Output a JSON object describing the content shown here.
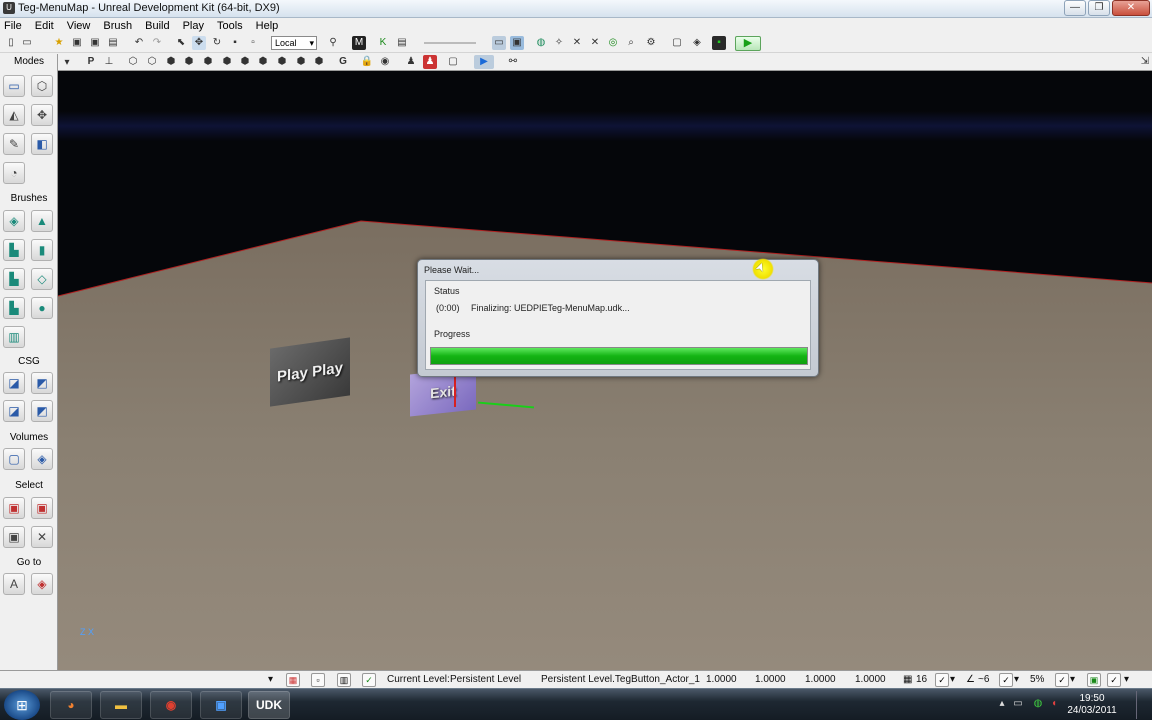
{
  "window": {
    "title": "Teg-MenuMap - Unreal Development Kit (64-bit, DX9)",
    "app_icon": "U",
    "minimize_glyph": "—",
    "maximize_glyph": "❐",
    "close_glyph": "✕"
  },
  "menu": [
    "File",
    "Edit",
    "View",
    "Brush",
    "Build",
    "Play",
    "Tools",
    "Help"
  ],
  "toolbar": {
    "coord_system": "Local",
    "play_glyph": "▶"
  },
  "modes": {
    "header": "Modes",
    "sections": {
      "brushes": "Brushes",
      "csg": "CSG",
      "volumes": "Volumes",
      "select": "Select",
      "goto": "Go to"
    }
  },
  "viewport": {
    "actors": {
      "play_button_text": "Play Play",
      "exit_button_text": "Exit"
    },
    "axes_label": "Z X"
  },
  "dialog": {
    "title": "Please Wait...",
    "status_label": "Status",
    "elapsed": "(0:00)",
    "message": "Finalizing: UEDPIETeg-MenuMap.udk...",
    "progress_label": "Progress",
    "progress": 1.0,
    "progress_color": "#14b414"
  },
  "statusbar": {
    "current_level_label": "Current Level:",
    "current_level_value": "Persistent Level",
    "selected_actor": "Persistent Level.TegButton_Actor_1",
    "drag_x": "1.0000",
    "drag_y": "1.0000",
    "drag_z": "1.0000",
    "drag_w": "1.0000",
    "grid_size": "16",
    "rotation_snap": "~6",
    "scale_snap": "5%"
  },
  "taskbar": {
    "start_glyph": "⊞",
    "apps": [
      "firefox-icon",
      "explorer-icon",
      "chrome-icon",
      "editor-icon",
      "UDK"
    ],
    "udk_label": "UDK",
    "time": "19:50",
    "date": "24/03/2011"
  }
}
